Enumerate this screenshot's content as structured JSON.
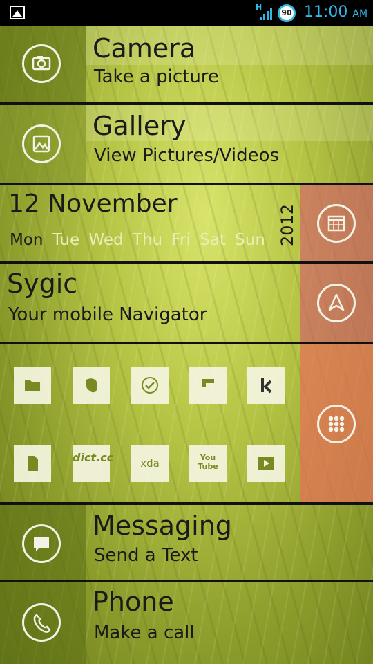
{
  "status_bar": {
    "network_type": "H",
    "battery_level": "90",
    "time": "11:00",
    "ampm": "AM",
    "accent_color": "#33b5e5"
  },
  "camera": {
    "title": "Camera",
    "subtitle": "Take a picture",
    "icon": "camera-icon"
  },
  "gallery": {
    "title": "Gallery",
    "subtitle": "View Pictures/Videos",
    "icon": "gallery-icon"
  },
  "calendar": {
    "date": "12  November",
    "year": "2012",
    "days": [
      "Mon",
      "Tue",
      "Wed",
      "Thu",
      "Fri",
      "Sat",
      "Sun"
    ],
    "icon": "calendar-icon"
  },
  "sygic": {
    "title": "Sygic",
    "subtitle": "Your mobile Navigator",
    "icon": "navigation-arrow-icon"
  },
  "apps": {
    "row1": [
      {
        "icon": "folder-icon",
        "label": ""
      },
      {
        "icon": "evernote-icon",
        "label": ""
      },
      {
        "icon": "checkmark-icon",
        "label": ""
      },
      {
        "icon": "flipboard-icon",
        "label": ""
      },
      {
        "icon": "kindle-icon",
        "label": ""
      }
    ],
    "row2": [
      {
        "icon": "document-icon",
        "label": ""
      },
      {
        "icon": "dictcc-icon",
        "label": "dict.cc"
      },
      {
        "icon": "xda-icon",
        "label": "xda"
      },
      {
        "icon": "youtube-icon",
        "label": "You Tube"
      },
      {
        "icon": "video-player-icon",
        "label": ""
      }
    ],
    "drawer_icon": "app-drawer-icon"
  },
  "messaging": {
    "title": "Messaging",
    "subtitle": "Send a Text",
    "icon": "message-icon"
  },
  "phone": {
    "title": "Phone",
    "subtitle": "Make a call",
    "icon": "phone-icon"
  },
  "colors": {
    "pink_panel": "#d75a6e",
    "salmon_panel": "#eb6e5a"
  }
}
